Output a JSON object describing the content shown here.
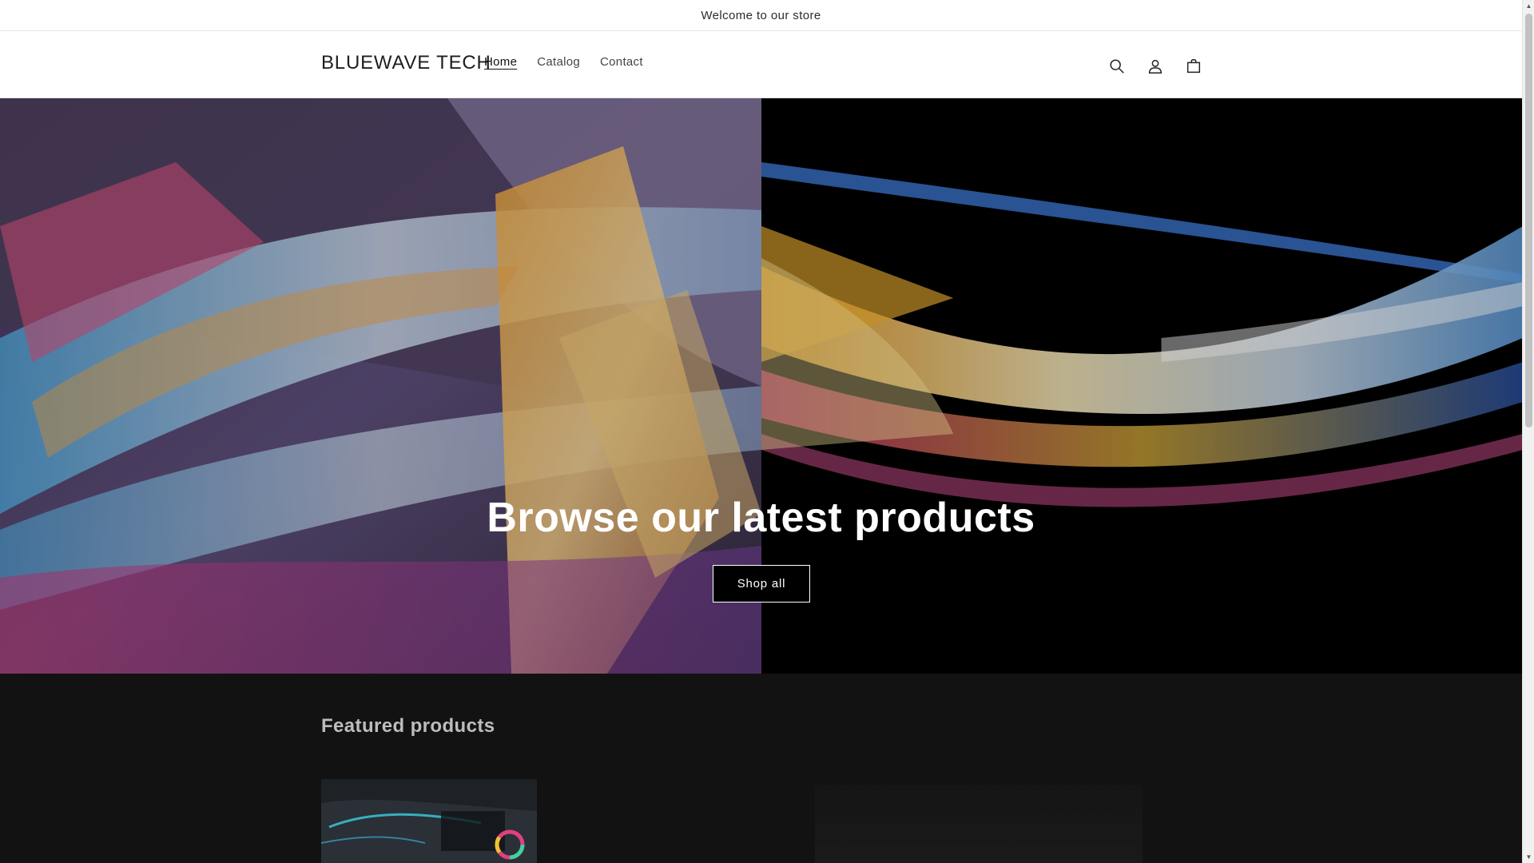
{
  "announcement": {
    "text": "Welcome to our store"
  },
  "header": {
    "logo": "BLUEWAVE TECH",
    "nav": [
      {
        "label": "Home",
        "active": true
      },
      {
        "label": "Catalog",
        "active": false
      },
      {
        "label": "Contact",
        "active": false
      }
    ],
    "icons": [
      "search-icon",
      "account-icon",
      "cart-icon"
    ]
  },
  "hero": {
    "title": "Browse our latest products",
    "button_label": "Shop all"
  },
  "featured": {
    "title": "Featured products"
  },
  "colors": {
    "header_bg": "#ffffff",
    "hero_bg": "#000000",
    "featured_bg": "#121212",
    "text": "#121212"
  }
}
